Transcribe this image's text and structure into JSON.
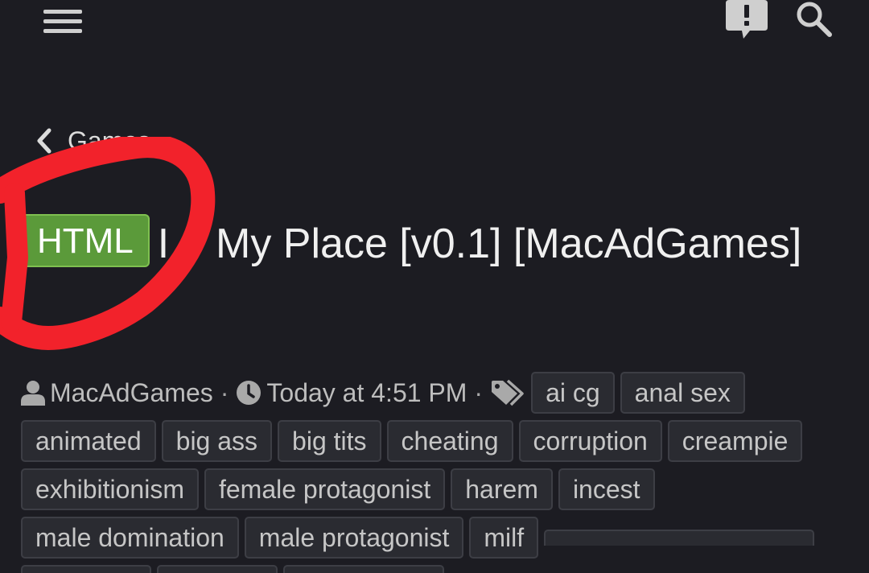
{
  "header": {
    "menu_icon": "hamburger-menu-icon",
    "alerts_icon": "alert-bubble-icon",
    "search_icon": "search-icon"
  },
  "breadcrumb": {
    "label": "Games",
    "icon": "chevron-left-icon"
  },
  "thread": {
    "prefix": "HTML",
    "title": "I    My Place [v0.1] [MacAdGames]",
    "prefix_color": "#5b9a3a"
  },
  "meta": {
    "author": "MacAdGames",
    "time": "Today at 4:51 PM",
    "separator": "·"
  },
  "tags": [
    "ai cg",
    "anal sex",
    "animated",
    "big ass",
    "big tits",
    "cheating",
    "corruption",
    "creampie",
    "exhibitionism",
    "female protagonist",
    "harem",
    "incest",
    "male domination",
    "male protagonist",
    "milf"
  ],
  "annotation_color": "#f2222b"
}
